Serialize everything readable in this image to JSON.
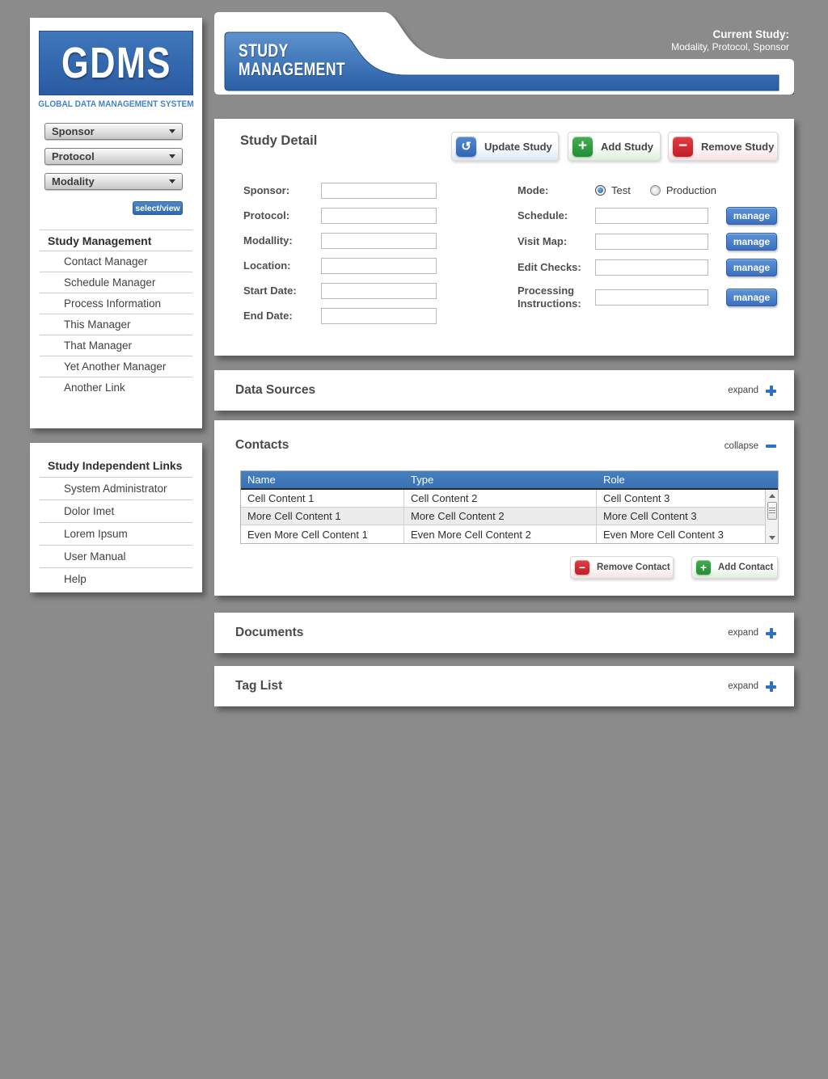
{
  "page": {
    "background": "#8b8b8b"
  },
  "sidebar": {
    "logo": {
      "title": "GDMS",
      "subtitle": "GLOBAL DATA MANAGEMENT SYSTEM"
    },
    "dropdowns": [
      {
        "label": "Sponsor"
      },
      {
        "label": "Protocol"
      },
      {
        "label": "Modality"
      }
    ],
    "select_view_label": "select/view",
    "nav": {
      "header": "Study Management",
      "items": [
        "Contact Manager",
        "Schedule Manager",
        "Process Information",
        "This Manager",
        "That Manager",
        "Yet Another Manager",
        "Another Link"
      ]
    },
    "independent": {
      "header": "Study Independent Links",
      "items": [
        "System Administrator",
        "Dolor Imet",
        "Lorem Ipsum",
        "User Manual",
        "Help"
      ]
    }
  },
  "header": {
    "title_line1": "STUDY",
    "title_line2": "MANAGEMENT",
    "current_study_label": "Current Study:",
    "current_study_value": "Modality, Protocol, Sponsor"
  },
  "study_detail": {
    "title": "Study Detail",
    "update_button": "Update Study",
    "add_button": "Add Study",
    "remove_button": "Remove Study",
    "fields_left": [
      {
        "label": "Sponsor:",
        "value": ""
      },
      {
        "label": "Protocol:",
        "value": ""
      },
      {
        "label": "Modallity:",
        "value": ""
      },
      {
        "label": "Location:",
        "value": ""
      },
      {
        "label": "Start Date:",
        "value": ""
      },
      {
        "label": "End Date:",
        "value": ""
      }
    ],
    "mode": {
      "label": "Mode:",
      "options": [
        {
          "label": "Test",
          "selected": true
        },
        {
          "label": "Production",
          "selected": false
        }
      ]
    },
    "fields_right": [
      {
        "label": "Schedule:",
        "value": ""
      },
      {
        "label": "Visit Map:",
        "value": ""
      },
      {
        "label": "Edit Checks:",
        "value": ""
      },
      {
        "label": "Processing Instructions:",
        "value": ""
      }
    ],
    "manage_label": "manage"
  },
  "data_sources": {
    "title": "Data Sources",
    "toggle_label": "expand"
  },
  "contacts": {
    "title": "Contacts",
    "toggle_label": "collapse",
    "table": {
      "columns": [
        "Name",
        "Type",
        "Role"
      ],
      "rows": [
        [
          "Cell Content 1",
          "Cell Content 2",
          "Cell Content 3"
        ],
        [
          "More Cell Content 1",
          "More Cell Content 2",
          "More Cell Content 3"
        ],
        [
          "Even More Cell Content 1",
          "Even More Cell Content 2",
          "Even More Cell Content 3"
        ]
      ]
    },
    "remove_button": "Remove Contact",
    "add_button": "Add Contact"
  },
  "documents": {
    "title": "Documents",
    "toggle_label": "expand"
  },
  "tag_list": {
    "title": "Tag List",
    "toggle_label": "expand"
  },
  "icons": {
    "update": "↺",
    "plus": "+",
    "minus": "−"
  },
  "colors": {
    "background": "#8b8b8b",
    "accent_blue": "#2f6cb5",
    "table_header_blue": "#3d79ba",
    "add_green": "#2f9c42",
    "remove_red": "#d6272f"
  }
}
